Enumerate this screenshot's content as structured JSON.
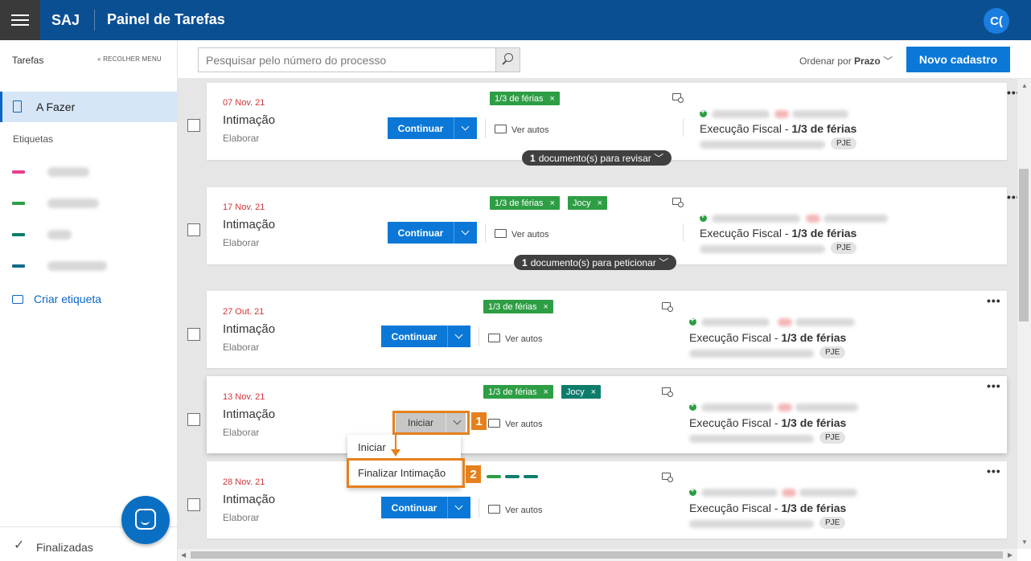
{
  "header": {
    "brand": "SAJ",
    "title": "Painel de Tarefas",
    "avatar_initials": "C("
  },
  "sidebar": {
    "title": "Tarefas",
    "collapse_label": "« RECOLHER MENU",
    "active_item": "A Fazer",
    "tags_heading": "Etiquetas",
    "tag_colors": [
      "#e83e8c",
      "#2e9e44",
      "#0e7c6b",
      "#0e6b8c"
    ],
    "create_tag": "Criar etiqueta",
    "footer_label": "Finalizadas"
  },
  "toolbar": {
    "search_placeholder": "Pesquisar pelo número do processo",
    "sort_prefix": "Ordenar por",
    "sort_value": "Prazo",
    "new_button": "Novo cadastro"
  },
  "tasks": [
    {
      "date": "07 Nov. 21",
      "type": "Intimação",
      "sub": "Elaborar",
      "action": "Continuar",
      "ver_autos": "Ver autos",
      "badges": [
        {
          "label": "1/3 de férias",
          "color": "green"
        }
      ],
      "exec_prefix": "Execução Fiscal - ",
      "exec_bold": "1/3 de férias",
      "system": "PJE",
      "pill_count": "1",
      "pill_text": "documento(s) para revisar"
    },
    {
      "date": "17 Nov. 21",
      "type": "Intimação",
      "sub": "Elaborar",
      "action": "Continuar",
      "ver_autos": "Ver autos",
      "badges": [
        {
          "label": "1/3 de férias",
          "color": "green"
        },
        {
          "label": "Jocy",
          "color": "green"
        }
      ],
      "exec_prefix": "Execução Fiscal - ",
      "exec_bold": "1/3 de férias",
      "system": "PJE",
      "pill_count": "1",
      "pill_text": "documento(s) para peticionar"
    },
    {
      "date": "27 Out. 21",
      "type": "Intimação",
      "sub": "Elaborar",
      "action": "Continuar",
      "ver_autos": "Ver autos",
      "badges": [
        {
          "label": "1/3 de férias",
          "color": "green"
        }
      ],
      "exec_prefix": "Execução Fiscal - ",
      "exec_bold": "1/3 de férias",
      "system": "PJE"
    },
    {
      "date": "13 Nov. 21",
      "type": "Intimação",
      "sub": "Elaborar",
      "action": "Iniciar",
      "ver_autos": "Ver autos",
      "badges": [
        {
          "label": "1/3 de férias",
          "color": "green"
        },
        {
          "label": "Jocy",
          "color": "teal"
        }
      ],
      "exec_prefix": "Execução Fiscal - ",
      "exec_bold": "1/3 de férias",
      "system": "PJE"
    },
    {
      "date": "28 Nov. 21",
      "type": "Intimação",
      "sub": "Elaborar",
      "action": "Continuar",
      "ver_autos": "Ver autos",
      "badges": [],
      "exec_prefix": "Execução Fiscal - ",
      "exec_bold": "1/3 de férias",
      "system": "PJE"
    }
  ],
  "dropdown": {
    "items": [
      "Iniciar",
      "Finalizar Intimação"
    ]
  },
  "annotations": [
    "1",
    "2"
  ],
  "more_icon": "•••",
  "badge_close": "×",
  "accent_colors": {
    "primary": "#0b78d7",
    "header": "#0b4f93",
    "highlight": "#e5801e",
    "date": "#d13438"
  }
}
